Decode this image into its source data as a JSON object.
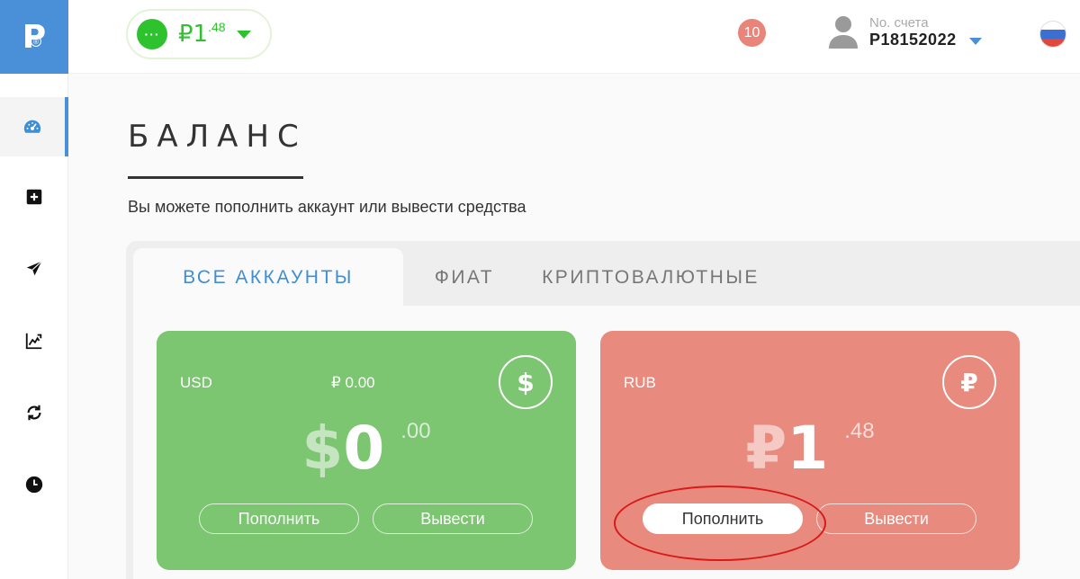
{
  "logo": {
    "letter": "P",
    "mark": "®"
  },
  "colors": {
    "accent": "#4a90d9",
    "green": "#2fc22f",
    "card_usd": "#7cc571",
    "card_rub": "#e88b7e",
    "badge": "#e9847a",
    "highlight": "#d81a1a"
  },
  "sidebar": {
    "items": [
      {
        "icon": "dashboard-icon",
        "active": true
      },
      {
        "icon": "plus-square-icon",
        "active": false
      },
      {
        "icon": "send-icon",
        "active": false
      },
      {
        "icon": "chart-icon",
        "active": false
      },
      {
        "icon": "exchange-icon",
        "active": false
      },
      {
        "icon": "history-icon",
        "active": false
      }
    ]
  },
  "header": {
    "balance": {
      "dots": "···",
      "symbol": "₽",
      "integer": "1",
      "cents": ".48"
    },
    "notifications": "10",
    "account": {
      "label": "No. счета",
      "number": "P18152022"
    },
    "language": "ru"
  },
  "page": {
    "title": "БАЛАНС",
    "subtitle": "Вы можете пополнить аккаунт или вывести средства"
  },
  "tabs": [
    {
      "label": "ВСЕ АККАУНТЫ",
      "active": true
    },
    {
      "label": "ФИАТ",
      "active": false
    },
    {
      "label": "КРИПТОВАЛЮТНЫЕ",
      "active": false
    }
  ],
  "cards": [
    {
      "currency": "USD",
      "converted": "₽ 0.00",
      "icon_symbol": "$",
      "amount_symbol": "$",
      "amount_int": "0",
      "amount_dec": ".00",
      "deposit_label": "Пополнить",
      "withdraw_label": "Вывести"
    },
    {
      "currency": "RUB",
      "converted": "",
      "icon_symbol": "₽",
      "amount_symbol": "₽",
      "amount_int": "1",
      "amount_dec": ".48",
      "deposit_label": "Пополнить",
      "withdraw_label": "Вывести"
    }
  ]
}
